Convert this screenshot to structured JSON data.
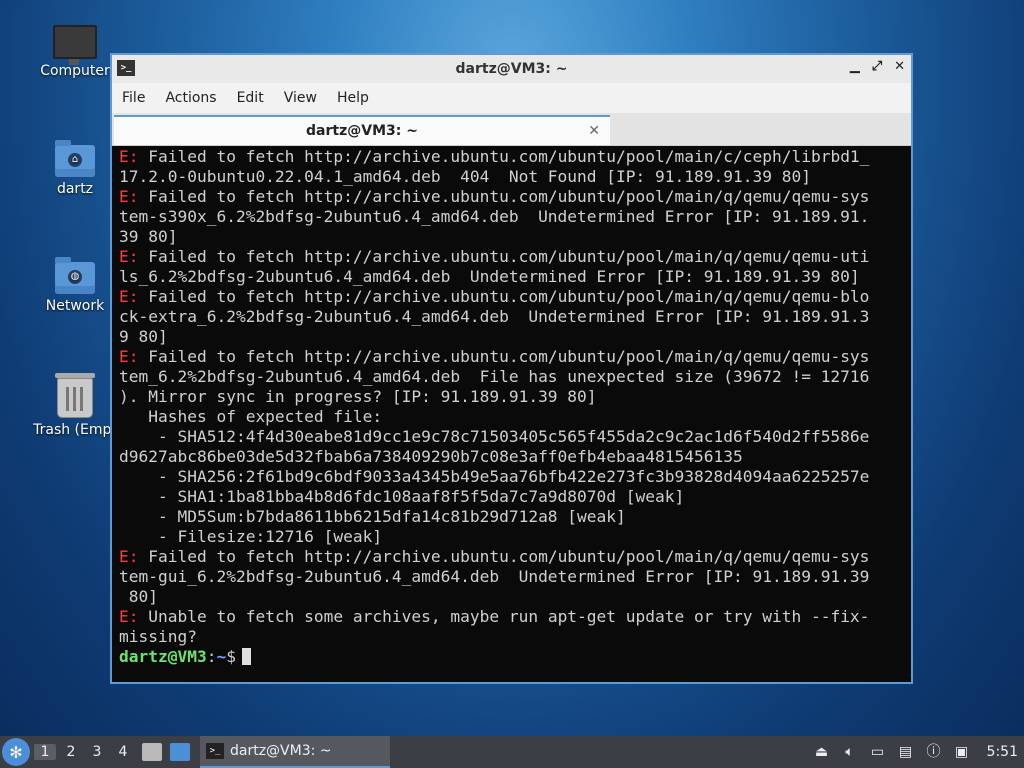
{
  "desktop": {
    "icons": [
      {
        "label": "Computer",
        "icon": "computer-icon"
      },
      {
        "label": "dartz",
        "icon": "home-folder-icon"
      },
      {
        "label": "Network",
        "icon": "network-folder-icon"
      },
      {
        "label": "Trash (Empt",
        "icon": "trash-icon"
      }
    ]
  },
  "window": {
    "title": "dartz@VM3: ~",
    "menu": [
      "File",
      "Actions",
      "Edit",
      "View",
      "Help"
    ],
    "tab_title": "dartz@VM3: ~"
  },
  "terminal": {
    "error_prefix": "E:",
    "lines": [
      " Failed to fetch http://archive.ubuntu.com/ubuntu/pool/main/c/ceph/librbd1_",
      "17.2.0-0ubuntu0.22.04.1_amd64.deb  404  Not Found [IP: 91.189.91.39 80]",
      " Failed to fetch http://archive.ubuntu.com/ubuntu/pool/main/q/qemu/qemu-sys",
      "tem-s390x_6.2%2bdfsg-2ubuntu6.4_amd64.deb  Undetermined Error [IP: 91.189.91.",
      "39 80]",
      " Failed to fetch http://archive.ubuntu.com/ubuntu/pool/main/q/qemu/qemu-uti",
      "ls_6.2%2bdfsg-2ubuntu6.4_amd64.deb  Undetermined Error [IP: 91.189.91.39 80]",
      " Failed to fetch http://archive.ubuntu.com/ubuntu/pool/main/q/qemu/qemu-blo",
      "ck-extra_6.2%2bdfsg-2ubuntu6.4_amd64.deb  Undetermined Error [IP: 91.189.91.3",
      "9 80]",
      " Failed to fetch http://archive.ubuntu.com/ubuntu/pool/main/q/qemu/qemu-sys",
      "tem_6.2%2bdfsg-2ubuntu6.4_amd64.deb  File has unexpected size (39672 != 12716",
      "). Mirror sync in progress? [IP: 91.189.91.39 80]",
      "   Hashes of expected file:",
      "    - SHA512:4f4d30eabe81d9cc1e9c78c71503405c565f455da2c9c2ac1d6f540d2ff5586e",
      "d9627abc86be03de5d32fbab6a738409290b7c08e3aff0efb4ebaa4815456135",
      "    - SHA256:2f61bd9c6bdf9033a4345b49e5aa76bfb422e273fc3b93828d4094aa6225257e",
      "    - SHA1:1ba81bba4b8d6fdc108aaf8f5f5da7c7a9d8070d [weak]",
      "    - MD5Sum:b7bda8611bb6215dfa14c81b29d712a8 [weak]",
      "    - Filesize:12716 [weak]",
      " Failed to fetch http://archive.ubuntu.com/ubuntu/pool/main/q/qemu/qemu-sys",
      "tem-gui_6.2%2bdfsg-2ubuntu6.4_amd64.deb  Undetermined Error [IP: 91.189.91.39",
      " 80]",
      " Unable to fetch some archives, maybe run apt-get update or try with --fix-",
      "missing?"
    ],
    "error_line_indices": [
      0,
      2,
      5,
      7,
      10,
      20,
      23
    ],
    "prompt_user": "dartz@VM3",
    "prompt_sep": ":",
    "prompt_path": "~",
    "prompt_symbol": "$"
  },
  "taskbar": {
    "workspaces": [
      "1",
      "2",
      "3",
      "4"
    ],
    "active_workspace": "1",
    "task_label": "dartz@VM3: ~",
    "clock": "5:51"
  },
  "colors": {
    "error": "#ff3b3b",
    "prompt_user": "#6be56b",
    "prompt_path": "#6aa4ff",
    "window_border": "#5f9bd3"
  }
}
